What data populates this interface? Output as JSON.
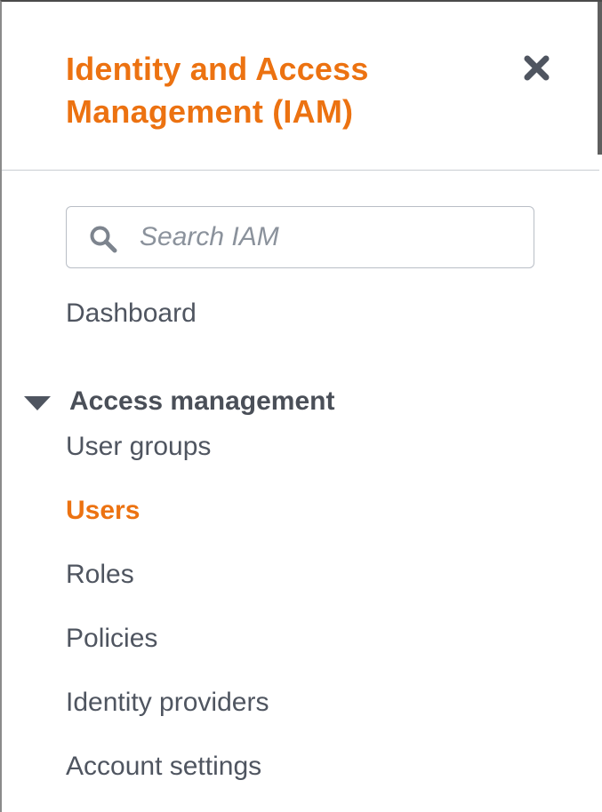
{
  "header": {
    "title": "Identity and Access Management (IAM)",
    "close_icon": "close-icon"
  },
  "search": {
    "placeholder": "Search IAM",
    "value": "",
    "icon": "search-icon"
  },
  "nav": {
    "dashboard": "Dashboard",
    "access_management": {
      "label": "Access management",
      "expanded": true,
      "icon": "caret-down-icon",
      "items": [
        {
          "label": "User groups",
          "active": false
        },
        {
          "label": "Users",
          "active": true
        },
        {
          "label": "Roles",
          "active": false
        },
        {
          "label": "Policies",
          "active": false
        },
        {
          "label": "Identity providers",
          "active": false
        },
        {
          "label": "Account settings",
          "active": false
        }
      ]
    }
  },
  "colors": {
    "accent": "#ec7211",
    "text": "#4f5560",
    "border": "#c9cdd3"
  }
}
